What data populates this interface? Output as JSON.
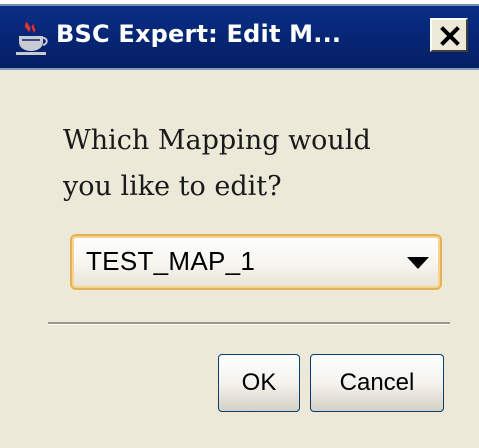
{
  "window": {
    "title": "BSC Expert: Edit M...",
    "app_icon": "java-coffee-cup-icon",
    "close_icon": "close-icon"
  },
  "prompt": {
    "line1": "Which Mapping would",
    "line2": "you like to edit?"
  },
  "mapping_select": {
    "selected": "TEST_MAP_1",
    "arrow_icon": "chevron-down-icon"
  },
  "buttons": {
    "ok_label": "OK",
    "cancel_label": "Cancel"
  },
  "colors": {
    "titlebar": "#062471",
    "dialog_bg": "#ece9d8",
    "combo_focus": "#e4b157"
  }
}
